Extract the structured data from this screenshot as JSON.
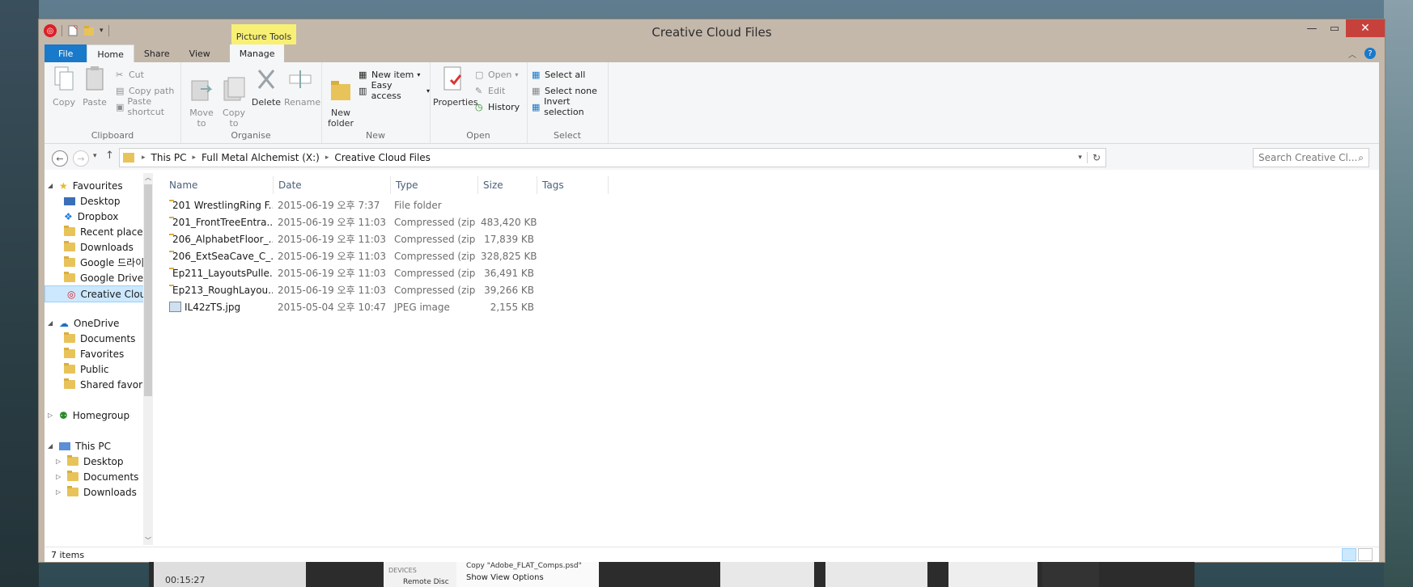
{
  "window": {
    "title": "Creative Cloud Files",
    "contextual_tab": "Picture Tools"
  },
  "tabs": [
    {
      "label": "File"
    },
    {
      "label": "Home"
    },
    {
      "label": "Share"
    },
    {
      "label": "View"
    },
    {
      "label": "Manage"
    }
  ],
  "ribbon": {
    "clipboard": {
      "label": "Clipboard",
      "copy": "Copy",
      "paste": "Paste",
      "cut": "Cut",
      "copy_path": "Copy path",
      "paste_shortcut": "Paste shortcut"
    },
    "organise": {
      "label": "Organise",
      "move_to": "Move\nto",
      "copy_to": "Copy\nto",
      "delete": "Delete",
      "rename": "Rename"
    },
    "new": {
      "label": "New",
      "new_folder": "New\nfolder",
      "new_item": "New item",
      "easy_access": "Easy access"
    },
    "open": {
      "label": "Open",
      "properties": "Properties",
      "open": "Open",
      "edit": "Edit",
      "history": "History"
    },
    "select": {
      "label": "Select",
      "select_all": "Select all",
      "select_none": "Select none",
      "invert_selection": "Invert selection"
    }
  },
  "address": {
    "crumbs": [
      "This PC",
      "Full Metal Alchemist (X:)",
      "Creative Cloud Files"
    ],
    "search_placeholder": "Search Creative Cl..."
  },
  "nav": {
    "favourites": "Favourites",
    "fav_items": [
      "Desktop",
      "Dropbox",
      "Recent places",
      "Downloads",
      "Google 드라이",
      "Google Drive",
      "Creative Cloud"
    ],
    "onedrive": "OneDrive",
    "onedrive_items": [
      "Documents",
      "Favorites",
      "Public",
      "Shared favorite"
    ],
    "homegroup": "Homegroup",
    "thispc": "This PC",
    "pc_items": [
      "Desktop",
      "Documents",
      "Downloads"
    ]
  },
  "columns": {
    "name": "Name",
    "date": "Date",
    "type": "Type",
    "size": "Size",
    "tags": "Tags"
  },
  "files": [
    {
      "name": "201 WrestlingRing F...",
      "date": "2015-06-19 오후 7:37",
      "type": "File folder",
      "size": ""
    },
    {
      "name": "201_FrontTreeEntra...",
      "date": "2015-06-19 오후 11:03",
      "type": "Compressed (zipp...",
      "size": "483,420 KB"
    },
    {
      "name": "206_AlphabetFloor_...",
      "date": "2015-06-19 오후 11:03",
      "type": "Compressed (zipp...",
      "size": "17,839 KB"
    },
    {
      "name": "206_ExtSeaCave_C_...",
      "date": "2015-06-19 오후 11:03",
      "type": "Compressed (zipp...",
      "size": "328,825 KB"
    },
    {
      "name": "Ep211_LayoutsPulle...",
      "date": "2015-06-19 오후 11:03",
      "type": "Compressed (zipp...",
      "size": "36,491 KB"
    },
    {
      "name": "Ep213_RoughLayou...",
      "date": "2015-06-19 오후 11:03",
      "type": "Compressed (zipp...",
      "size": "39,266 KB"
    },
    {
      "name": "IL42zTS.jpg",
      "date": "2015-05-04 오후 10:47",
      "type": "JPEG image",
      "size": "2,155 KB"
    }
  ],
  "status": {
    "count": "7 items"
  },
  "taskbar": {
    "time_label": "00:15:27",
    "menu_item": "Show View Options",
    "menu_item2": "Copy \"Adobe_FLAT_Comps.psd\"",
    "devices": "DEVICES",
    "remote_disc": "Remote Disc"
  }
}
